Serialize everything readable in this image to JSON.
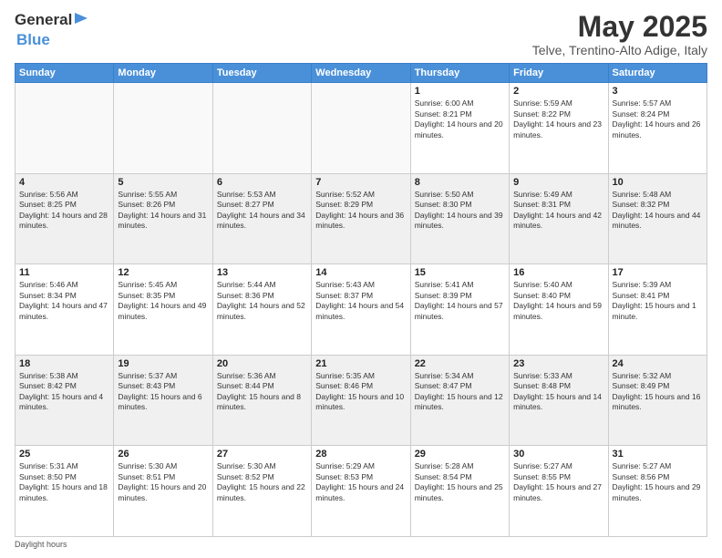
{
  "header": {
    "logo_general": "General",
    "logo_blue": "Blue",
    "title": "May 2025",
    "location": "Telve, Trentino-Alto Adige, Italy"
  },
  "weekdays": [
    "Sunday",
    "Monday",
    "Tuesday",
    "Wednesday",
    "Thursday",
    "Friday",
    "Saturday"
  ],
  "weeks": [
    [
      {
        "day": "",
        "empty": true
      },
      {
        "day": "",
        "empty": true
      },
      {
        "day": "",
        "empty": true
      },
      {
        "day": "",
        "empty": true
      },
      {
        "day": "1",
        "sunrise": "6:00 AM",
        "sunset": "8:21 PM",
        "daylight": "14 hours and 20 minutes."
      },
      {
        "day": "2",
        "sunrise": "5:59 AM",
        "sunset": "8:22 PM",
        "daylight": "14 hours and 23 minutes."
      },
      {
        "day": "3",
        "sunrise": "5:57 AM",
        "sunset": "8:24 PM",
        "daylight": "14 hours and 26 minutes."
      }
    ],
    [
      {
        "day": "4",
        "sunrise": "5:56 AM",
        "sunset": "8:25 PM",
        "daylight": "14 hours and 28 minutes."
      },
      {
        "day": "5",
        "sunrise": "5:55 AM",
        "sunset": "8:26 PM",
        "daylight": "14 hours and 31 minutes."
      },
      {
        "day": "6",
        "sunrise": "5:53 AM",
        "sunset": "8:27 PM",
        "daylight": "14 hours and 34 minutes."
      },
      {
        "day": "7",
        "sunrise": "5:52 AM",
        "sunset": "8:29 PM",
        "daylight": "14 hours and 36 minutes."
      },
      {
        "day": "8",
        "sunrise": "5:50 AM",
        "sunset": "8:30 PM",
        "daylight": "14 hours and 39 minutes."
      },
      {
        "day": "9",
        "sunrise": "5:49 AM",
        "sunset": "8:31 PM",
        "daylight": "14 hours and 42 minutes."
      },
      {
        "day": "10",
        "sunrise": "5:48 AM",
        "sunset": "8:32 PM",
        "daylight": "14 hours and 44 minutes."
      }
    ],
    [
      {
        "day": "11",
        "sunrise": "5:46 AM",
        "sunset": "8:34 PM",
        "daylight": "14 hours and 47 minutes."
      },
      {
        "day": "12",
        "sunrise": "5:45 AM",
        "sunset": "8:35 PM",
        "daylight": "14 hours and 49 minutes."
      },
      {
        "day": "13",
        "sunrise": "5:44 AM",
        "sunset": "8:36 PM",
        "daylight": "14 hours and 52 minutes."
      },
      {
        "day": "14",
        "sunrise": "5:43 AM",
        "sunset": "8:37 PM",
        "daylight": "14 hours and 54 minutes."
      },
      {
        "day": "15",
        "sunrise": "5:41 AM",
        "sunset": "8:39 PM",
        "daylight": "14 hours and 57 minutes."
      },
      {
        "day": "16",
        "sunrise": "5:40 AM",
        "sunset": "8:40 PM",
        "daylight": "14 hours and 59 minutes."
      },
      {
        "day": "17",
        "sunrise": "5:39 AM",
        "sunset": "8:41 PM",
        "daylight": "15 hours and 1 minute."
      }
    ],
    [
      {
        "day": "18",
        "sunrise": "5:38 AM",
        "sunset": "8:42 PM",
        "daylight": "15 hours and 4 minutes."
      },
      {
        "day": "19",
        "sunrise": "5:37 AM",
        "sunset": "8:43 PM",
        "daylight": "15 hours and 6 minutes."
      },
      {
        "day": "20",
        "sunrise": "5:36 AM",
        "sunset": "8:44 PM",
        "daylight": "15 hours and 8 minutes."
      },
      {
        "day": "21",
        "sunrise": "5:35 AM",
        "sunset": "8:46 PM",
        "daylight": "15 hours and 10 minutes."
      },
      {
        "day": "22",
        "sunrise": "5:34 AM",
        "sunset": "8:47 PM",
        "daylight": "15 hours and 12 minutes."
      },
      {
        "day": "23",
        "sunrise": "5:33 AM",
        "sunset": "8:48 PM",
        "daylight": "15 hours and 14 minutes."
      },
      {
        "day": "24",
        "sunrise": "5:32 AM",
        "sunset": "8:49 PM",
        "daylight": "15 hours and 16 minutes."
      }
    ],
    [
      {
        "day": "25",
        "sunrise": "5:31 AM",
        "sunset": "8:50 PM",
        "daylight": "15 hours and 18 minutes."
      },
      {
        "day": "26",
        "sunrise": "5:30 AM",
        "sunset": "8:51 PM",
        "daylight": "15 hours and 20 minutes."
      },
      {
        "day": "27",
        "sunrise": "5:30 AM",
        "sunset": "8:52 PM",
        "daylight": "15 hours and 22 minutes."
      },
      {
        "day": "28",
        "sunrise": "5:29 AM",
        "sunset": "8:53 PM",
        "daylight": "15 hours and 24 minutes."
      },
      {
        "day": "29",
        "sunrise": "5:28 AM",
        "sunset": "8:54 PM",
        "daylight": "15 hours and 25 minutes."
      },
      {
        "day": "30",
        "sunrise": "5:27 AM",
        "sunset": "8:55 PM",
        "daylight": "15 hours and 27 minutes."
      },
      {
        "day": "31",
        "sunrise": "5:27 AM",
        "sunset": "8:56 PM",
        "daylight": "15 hours and 29 minutes."
      }
    ]
  ],
  "footer": {
    "note": "Daylight hours"
  }
}
